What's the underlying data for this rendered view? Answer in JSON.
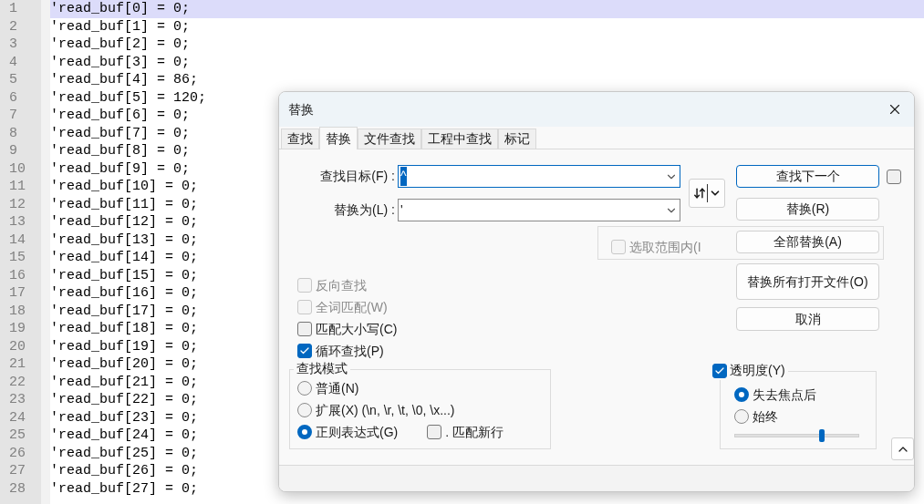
{
  "editor": {
    "lines": [
      {
        "number": "1",
        "text": "'read_buf[0] = 0;",
        "selected": true
      },
      {
        "number": "2",
        "text": "'read_buf[1] = 0;",
        "selected": false
      },
      {
        "number": "3",
        "text": "'read_buf[2] = 0;",
        "selected": false
      },
      {
        "number": "4",
        "text": "'read_buf[3] = 0;",
        "selected": false
      },
      {
        "number": "5",
        "text": "'read_buf[4] = 86;",
        "selected": false
      },
      {
        "number": "6",
        "text": "'read_buf[5] = 120;",
        "selected": false
      },
      {
        "number": "7",
        "text": "'read_buf[6] = 0;",
        "selected": false
      },
      {
        "number": "8",
        "text": "'read_buf[7] = 0;",
        "selected": false
      },
      {
        "number": "9",
        "text": "'read_buf[8] = 0;",
        "selected": false
      },
      {
        "number": "10",
        "text": "'read_buf[9] = 0;",
        "selected": false
      },
      {
        "number": "11",
        "text": "'read_buf[10] = 0;",
        "selected": false
      },
      {
        "number": "12",
        "text": "'read_buf[11] = 0;",
        "selected": false
      },
      {
        "number": "13",
        "text": "'read_buf[12] = 0;",
        "selected": false
      },
      {
        "number": "14",
        "text": "'read_buf[13] = 0;",
        "selected": false
      },
      {
        "number": "15",
        "text": "'read_buf[14] = 0;",
        "selected": false
      },
      {
        "number": "16",
        "text": "'read_buf[15] = 0;",
        "selected": false
      },
      {
        "number": "17",
        "text": "'read_buf[16] = 0;",
        "selected": false
      },
      {
        "number": "18",
        "text": "'read_buf[17] = 0;",
        "selected": false
      },
      {
        "number": "19",
        "text": "'read_buf[18] = 0;",
        "selected": false
      },
      {
        "number": "20",
        "text": "'read_buf[19] = 0;",
        "selected": false
      },
      {
        "number": "21",
        "text": "'read_buf[20] = 0;",
        "selected": false
      },
      {
        "number": "22",
        "text": "'read_buf[21] = 0;",
        "selected": false
      },
      {
        "number": "23",
        "text": "'read_buf[22] = 0;",
        "selected": false
      },
      {
        "number": "24",
        "text": "'read_buf[23] = 0;",
        "selected": false
      },
      {
        "number": "25",
        "text": "'read_buf[24] = 0;",
        "selected": false
      },
      {
        "number": "26",
        "text": "'read_buf[25] = 0;",
        "selected": false
      },
      {
        "number": "27",
        "text": "'read_buf[26] = 0;",
        "selected": false
      },
      {
        "number": "28",
        "text": "'read_buf[27] = 0;",
        "selected": false
      }
    ]
  },
  "dialog": {
    "title": "替换",
    "tabs": [
      {
        "label": "查找",
        "selected": false
      },
      {
        "label": "替换",
        "selected": true
      },
      {
        "label": "文件查找",
        "selected": false
      },
      {
        "label": "工程中查找",
        "selected": false
      },
      {
        "label": "标记",
        "selected": false
      }
    ],
    "find": {
      "label": "查找目标(F) :",
      "value": "^",
      "highlighted": true
    },
    "replace": {
      "label": "替换为(L) :",
      "value": "'",
      "highlighted": false
    },
    "buttons": [
      {
        "label": "查找下一个",
        "focused": true
      },
      {
        "label": "替换(R)",
        "focused": false
      },
      {
        "label": "全部替换(A)",
        "focused": false
      },
      {
        "label": "替换所有打开文件(O)",
        "focused": false
      },
      {
        "label": "取消",
        "focused": false
      }
    ],
    "side_checkbox": {
      "checked": false
    },
    "in_selection": {
      "label": "选取范围内(I",
      "checked": false,
      "disabled": true
    },
    "options": [
      {
        "label": "反向查找",
        "checked": false,
        "disabled": true
      },
      {
        "label": "全词匹配(W)",
        "checked": false,
        "disabled": true
      },
      {
        "label": "匹配大小写(C)",
        "checked": false,
        "disabled": false
      },
      {
        "label": "循环查找(P)",
        "checked": true,
        "disabled": false
      }
    ],
    "search_mode": {
      "title": "查找模式",
      "modes": [
        {
          "label": "普通(N)",
          "selected": false
        },
        {
          "label": "扩展(X) (\\n, \\r, \\t, \\0, \\x...)",
          "selected": false
        },
        {
          "label": "正则表达式(G)",
          "selected": true
        }
      ],
      "dot_newline": {
        "label": ". 匹配新行",
        "checked": false
      }
    },
    "transparency": {
      "label": "透明度(Y)",
      "checked": true,
      "modes": [
        {
          "label": "失去焦点后",
          "selected": true
        },
        {
          "label": "始终",
          "selected": false
        }
      ],
      "level": 0.71
    }
  }
}
